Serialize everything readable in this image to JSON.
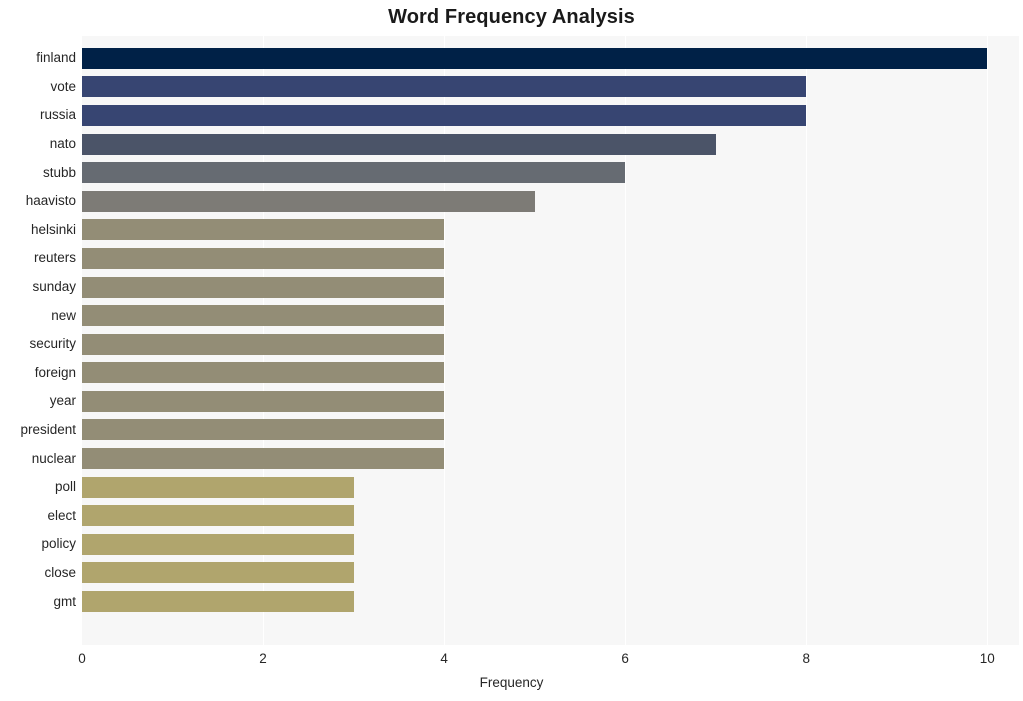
{
  "chart_data": {
    "type": "bar",
    "orientation": "horizontal",
    "title": "Word Frequency Analysis",
    "xlabel": "Frequency",
    "ylabel": "",
    "xlim": [
      0,
      10.35
    ],
    "xticks": [
      0,
      2,
      4,
      6,
      8,
      10
    ],
    "xtick_labels": [
      "0",
      "2",
      "4",
      "6",
      "8",
      "10"
    ],
    "grid": true,
    "grid_axis": "x",
    "legend": null,
    "categories": [
      "finland",
      "vote",
      "russia",
      "nato",
      "stubb",
      "haavisto",
      "helsinki",
      "reuters",
      "sunday",
      "new",
      "security",
      "foreign",
      "year",
      "president",
      "nuclear",
      "poll",
      "elect",
      "policy",
      "close",
      "gmt"
    ],
    "values": [
      10,
      8,
      8,
      7,
      6,
      5,
      4,
      4,
      4,
      4,
      4,
      4,
      4,
      4,
      4,
      3,
      3,
      3,
      3,
      3
    ],
    "bar_colors": [
      "#002147",
      "#374572",
      "#374572",
      "#4b5468",
      "#666b72",
      "#7d7b76",
      "#938d76",
      "#938d76",
      "#938d76",
      "#938d76",
      "#938d76",
      "#938d76",
      "#938d76",
      "#938d76",
      "#938d76",
      "#b0a56d",
      "#b0a56d",
      "#b0a56d",
      "#b0a56d",
      "#b0a56d"
    ]
  },
  "style": {
    "plot_background": "#f7f7f7",
    "figure_background": "#ffffff",
    "gridline_color": "#ffffff",
    "text_color": "#262626",
    "title_color": "#1a1a1a"
  }
}
